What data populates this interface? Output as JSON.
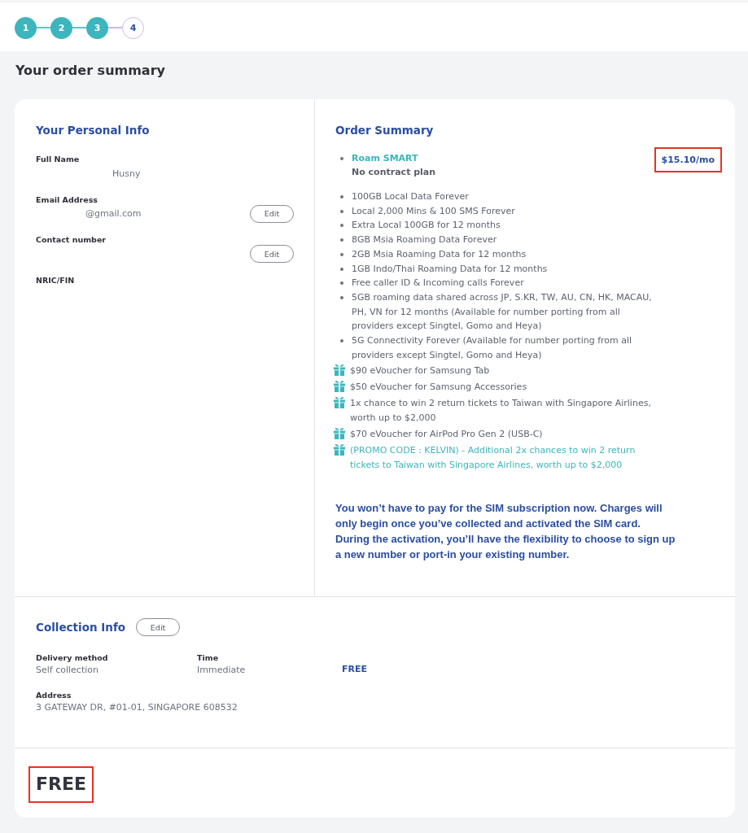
{
  "stepper": {
    "steps": [
      {
        "label": "1",
        "completed": true
      },
      {
        "label": "2",
        "completed": true
      },
      {
        "label": "3",
        "completed": true
      },
      {
        "label": "4",
        "completed": false
      }
    ]
  },
  "page_title": "Your order summary",
  "personal_info": {
    "title": "Your Personal Info",
    "fields": [
      {
        "label": "Full Name",
        "value": "Husny"
      },
      {
        "label": "Email Address",
        "value": "@gmail.com",
        "action": "Edit"
      },
      {
        "label": "Contact number",
        "action": "Edit"
      },
      {
        "label": "NRIC/FIN"
      }
    ]
  },
  "order_summary": {
    "title": "Order Summary",
    "plan": {
      "name": "Roam SMART",
      "subtitle": "No contract plan",
      "price": "$15.10/mo",
      "highlighted": true
    },
    "items": [
      {
        "kind": "bullet",
        "text": "100GB Local Data Forever"
      },
      {
        "kind": "bullet",
        "text": "Local 2,000 Mins & 100 SMS Forever"
      },
      {
        "kind": "bullet",
        "text": "Extra Local 100GB for 12 months"
      },
      {
        "kind": "bullet",
        "text": "8GB Msia Roaming Data Forever"
      },
      {
        "kind": "bullet",
        "text": "2GB Msia Roaming Data for 12 months"
      },
      {
        "kind": "bullet",
        "text": "1GB Indo/Thai Roaming Data for 12 months"
      },
      {
        "kind": "bullet",
        "text": "Free caller ID & Incoming calls Forever"
      },
      {
        "kind": "bullet",
        "text": "5GB roaming data shared across JP, S.KR, TW, AU, CN, HK, MACAU, PH, VN for 12 months (Available for number porting from all providers except Singtel, Gomo and Heya)"
      },
      {
        "kind": "bullet",
        "text": "5G Connectivity Forever (Available for number porting from all providers except Singtel, Gomo and Heya)"
      },
      {
        "kind": "gift",
        "text": "$90 eVoucher for Samsung Tab"
      },
      {
        "kind": "gift",
        "text": "$50 eVoucher for Samsung Accessories"
      },
      {
        "kind": "gift",
        "text": "1x chance to win 2 return tickets to Taiwan with Singapore Airlines, worth up to $2,000"
      },
      {
        "kind": "gift",
        "text": "$70 eVoucher for AirPod Pro Gen 2 (USB-C)"
      },
      {
        "kind": "promo",
        "text": "(PROMO CODE : KELVIN) - Additional 2x chances to win 2 return tickets to Taiwan with Singapore Airlines, worth up to $2,000"
      }
    ],
    "notice": "You won’t have to pay for the SIM subscription now. Charges will only begin once you’ve collected and activated the SIM card. During the activation, you’ll have the flexibility to choose to sign up a new number or port-in your existing number."
  },
  "collection_info": {
    "title": "Collection Info",
    "action": "Edit",
    "fields": [
      {
        "label": "Delivery method",
        "value": "Self collection"
      },
      {
        "label": "Time",
        "value": "Immediate"
      }
    ],
    "fee": "FREE",
    "address": {
      "label": "Address",
      "value": "3 GATEWAY DR, #01-01, SINGAPORE 608532"
    }
  },
  "total": {
    "text": "FREE",
    "highlighted": true
  }
}
